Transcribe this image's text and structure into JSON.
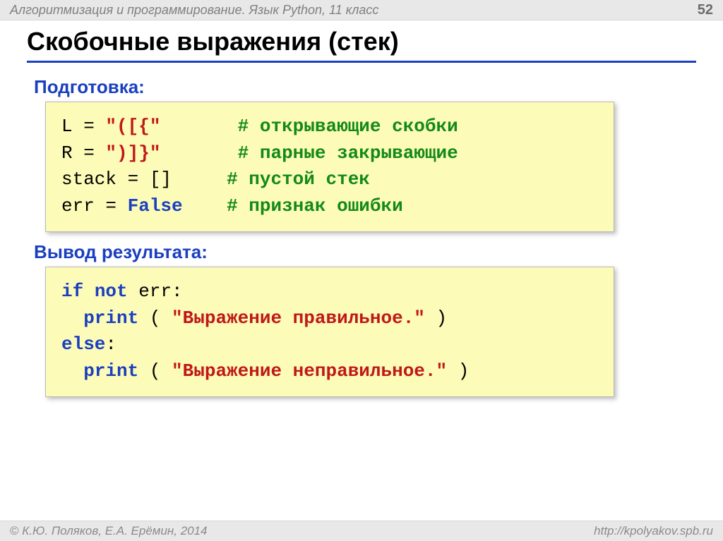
{
  "topbar": {
    "title": "Алгоритмизация и программирование. Язык Python, 11 класс",
    "page": "52"
  },
  "heading": "Скобочные выражения (стек)",
  "section": {
    "prep": "Подготовка:",
    "output": "Вывод результата:"
  },
  "code1": {
    "line1": {
      "left": "L = ",
      "lit": "\"([{\"",
      "pad": "       ",
      "cmt": "# открывающие скобки"
    },
    "line2": {
      "left": "R = ",
      "lit": "\")]}\"",
      "pad": "       ",
      "cmt": "# парные закрывающие"
    },
    "line3": {
      "left": "stack = ",
      "lit": "[]",
      "pad": "     ",
      "cmt": "# пустой стек"
    },
    "line4": {
      "left": "err = ",
      "lit": "False",
      "pad": "    ",
      "cmt": "# признак ошибки"
    }
  },
  "code2": {
    "kw_if": "if",
    "kw_not": "not",
    "var_err": " err:",
    "indent": "  ",
    "fn_print": "print",
    "open_paren": " ( ",
    "close_paren": " )",
    "str_ok": "\"Выражение правильное.\"",
    "kw_else": "else",
    "colon": ":",
    "str_bad": "\"Выражение неправильное.\""
  },
  "footer": {
    "left": "К.Ю. Поляков, Е.А. Ерёмин, 2014",
    "right": "http://kpolyakov.spb.ru"
  }
}
